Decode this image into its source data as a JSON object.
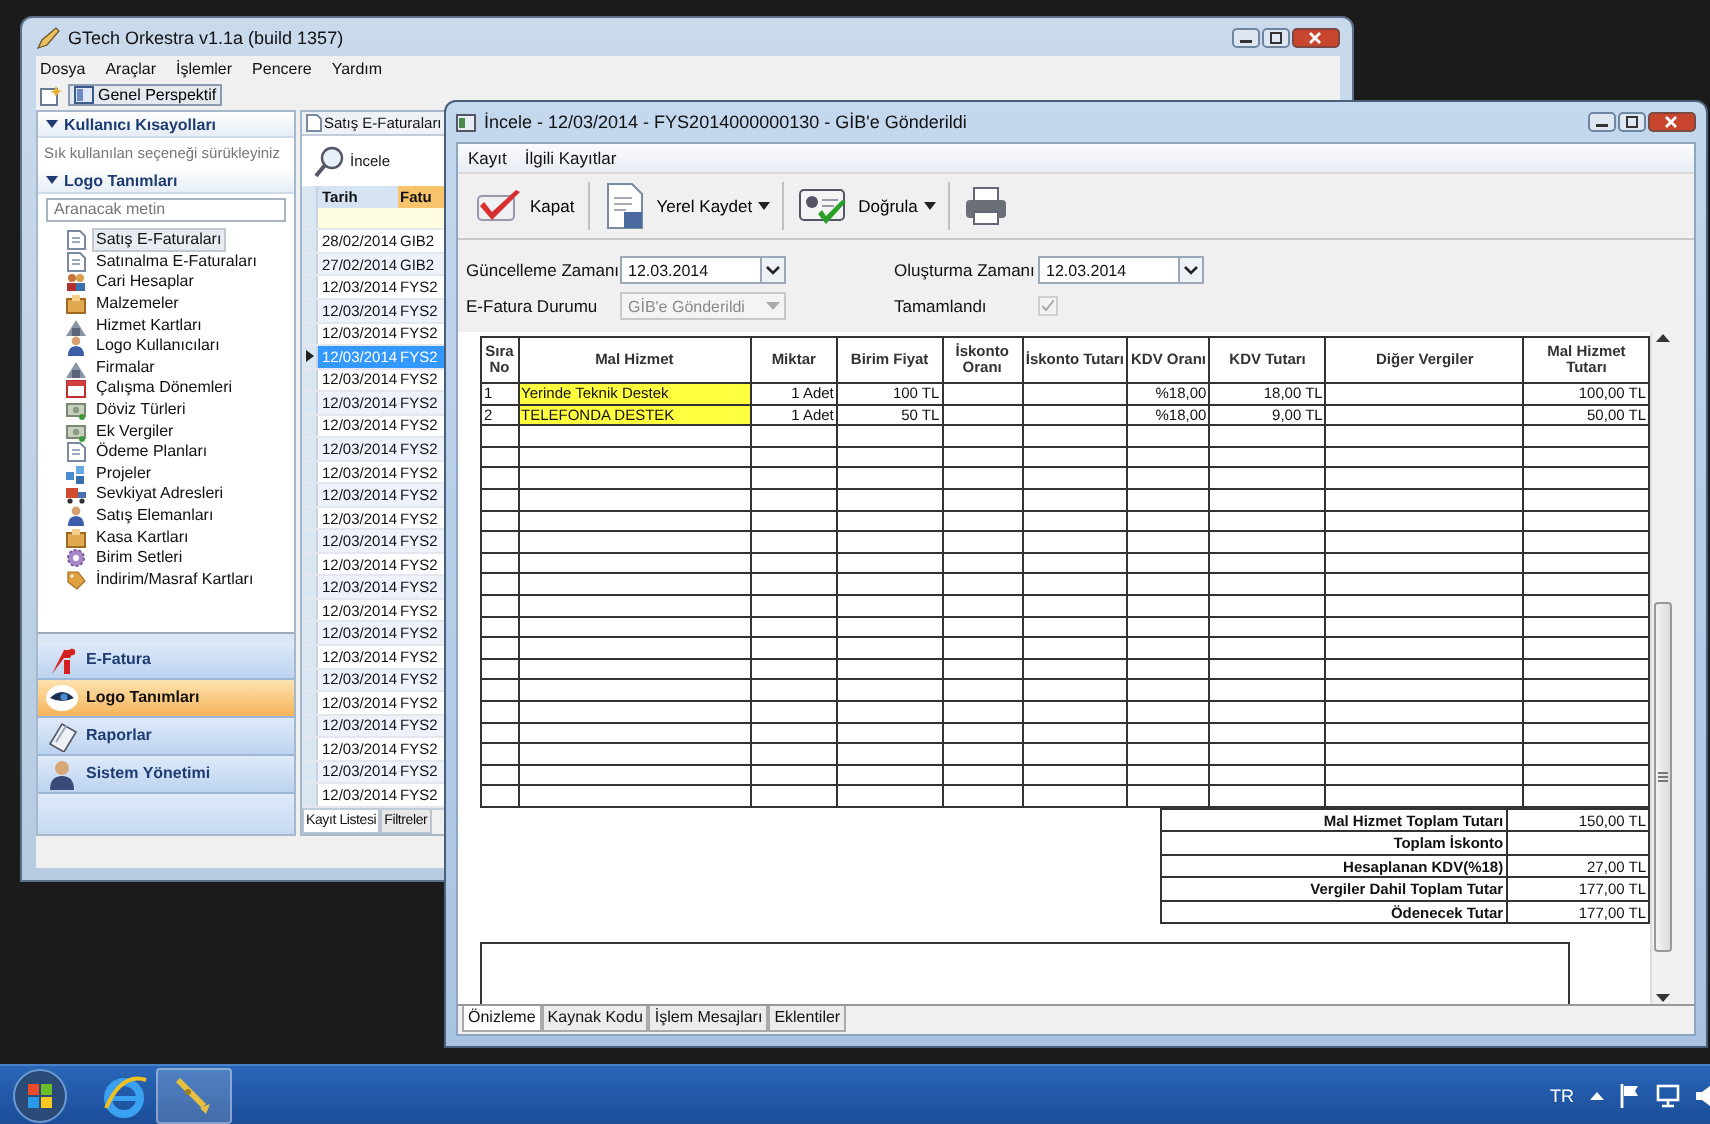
{
  "main_window": {
    "title": "GTech Orkestra v1.1a (build 1357)",
    "menu": [
      "Dosya",
      "Araçlar",
      "İşlemler",
      "Pencere",
      "Yardım"
    ],
    "perspective_button": "Genel Perspektif",
    "shortcuts": {
      "title": "Kullanıcı Kısayolları",
      "expanded": true,
      "hint": "Sık kullanılan seçeneği sürükleyiniz"
    },
    "definitions": {
      "title": "Logo Tanımları",
      "expanded": true,
      "search": {
        "placeholder": "Aranacak metin"
      },
      "items": [
        {
          "label": "Satış E-Faturaları",
          "selected": true
        },
        {
          "label": "Satınalma E-Faturaları",
          "selected": false
        },
        {
          "label": "Cari Hesaplar",
          "selected": false
        },
        {
          "label": "Malzemeler",
          "selected": false
        },
        {
          "label": "Hizmet Kartları",
          "selected": false
        },
        {
          "label": "Logo Kullanıcıları",
          "selected": false
        },
        {
          "label": "Firmalar",
          "selected": false
        },
        {
          "label": "Çalışma Dönemleri",
          "selected": false
        },
        {
          "label": "Döviz Türleri",
          "selected": false
        },
        {
          "label": "Ek Vergiler",
          "selected": false
        },
        {
          "label": "Ödeme Planları",
          "selected": false
        },
        {
          "label": "Projeler",
          "selected": false
        },
        {
          "label": "Sevkiyat Adresleri",
          "selected": false
        },
        {
          "label": "Satış Elemanları",
          "selected": false
        },
        {
          "label": "Kasa Kartları",
          "selected": false
        },
        {
          "label": "Birim Setleri",
          "selected": false
        },
        {
          "label": "İndirim/Masraf Kartları",
          "selected": false
        }
      ]
    },
    "nav": [
      {
        "label": "E-Fatura",
        "selected": false
      },
      {
        "label": "Logo Tanımları",
        "selected": true
      },
      {
        "label": "Raporlar",
        "selected": false
      },
      {
        "label": "Sistem Yönetimi",
        "selected": false
      }
    ],
    "list": {
      "tab": "Satış E-Faturaları",
      "toolbar": [
        "İncele"
      ],
      "columns": [
        {
          "label": "Tarih",
          "sorted": false
        },
        {
          "label": "Fatu",
          "sorted": true
        }
      ],
      "rows": [
        {
          "date": "28/02/2014",
          "number": "GIB2",
          "selected": false
        },
        {
          "date": "27/02/2014",
          "number": "GIB2",
          "selected": false
        },
        {
          "date": "12/03/2014",
          "number": "FYS2",
          "selected": false
        },
        {
          "date": "12/03/2014",
          "number": "FYS2",
          "selected": false
        },
        {
          "date": "12/03/2014",
          "number": "FYS2",
          "selected": false
        },
        {
          "date": "12/03/2014",
          "number": "FYS2",
          "selected": true
        },
        {
          "date": "12/03/2014",
          "number": "FYS2",
          "selected": false
        },
        {
          "date": "12/03/2014",
          "number": "FYS2",
          "selected": false
        },
        {
          "date": "12/03/2014",
          "number": "FYS2",
          "selected": false
        },
        {
          "date": "12/03/2014",
          "number": "FYS2",
          "selected": false
        },
        {
          "date": "12/03/2014",
          "number": "FYS2",
          "selected": false
        },
        {
          "date": "12/03/2014",
          "number": "FYS2",
          "selected": false
        },
        {
          "date": "12/03/2014",
          "number": "FYS2",
          "selected": false
        },
        {
          "date": "12/03/2014",
          "number": "FYS2",
          "selected": false
        },
        {
          "date": "12/03/2014",
          "number": "FYS2",
          "selected": false
        },
        {
          "date": "12/03/2014",
          "number": "FYS2",
          "selected": false
        },
        {
          "date": "12/03/2014",
          "number": "FYS2",
          "selected": false
        },
        {
          "date": "12/03/2014",
          "number": "FYS2",
          "selected": false
        },
        {
          "date": "12/03/2014",
          "number": "FYS2",
          "selected": false
        },
        {
          "date": "12/03/2014",
          "number": "FYS2",
          "selected": false
        },
        {
          "date": "12/03/2014",
          "number": "FYS2",
          "selected": false
        },
        {
          "date": "12/03/2014",
          "number": "FYS2",
          "selected": false
        },
        {
          "date": "12/03/2014",
          "number": "FYS2",
          "selected": false
        },
        {
          "date": "12/03/2014",
          "number": "FYS2",
          "selected": false
        },
        {
          "date": "12/03/2014",
          "number": "FYS2",
          "selected": false
        }
      ],
      "bottom_tabs": [
        {
          "label": "Kayıt Listesi",
          "selected": true
        },
        {
          "label": "Filtreler",
          "selected": false
        }
      ]
    }
  },
  "dialog": {
    "title": "İncele - 12/03/2014 - FYS2014000000130 - GİB'e Gönderildi",
    "menu": [
      "Kayıt",
      "İlgili Kayıtlar"
    ],
    "toolbar": [
      {
        "kind": "close",
        "label": "Kapat",
        "dropdown": false
      },
      {
        "kind": "save",
        "label": "Yerel Kaydet",
        "dropdown": true
      },
      {
        "kind": "verify",
        "label": "Doğrula",
        "dropdown": true
      },
      {
        "kind": "print",
        "dropdown": false
      }
    ],
    "fields": [
      {
        "kind": "date",
        "label": "Güncelleme Zamanı",
        "value": "12.03.2014",
        "disabled": false
      },
      {
        "kind": "date",
        "label": "Oluşturma Zamanı",
        "value": "12.03.2014",
        "disabled": false
      },
      {
        "kind": "combo",
        "label": "E-Fatura Durumu",
        "value": "GİB'e Gönderildi",
        "disabled": true
      },
      {
        "kind": "checkbox",
        "label": "Tamamlandı",
        "checked": true,
        "disabled": true
      }
    ],
    "table": {
      "columns": [
        "Sıra No",
        "Mal Hizmet",
        "Miktar",
        "Birim Fiyat",
        "İskonto Oranı",
        "İskonto Tutarı",
        "KDV Oranı",
        "KDV Tutarı",
        "Diğer Vergiler",
        "Mal Hizmet Tutarı"
      ],
      "rows": [
        {
          "no": "1",
          "item": "Yerinde Teknik Destek",
          "quantity": "1 Adet",
          "unit_price": "100 TL",
          "vat_rate": "%18,00",
          "vat_amount": "18,00 TL",
          "line_total": "100,00 TL",
          "highlighted": true
        },
        {
          "no": "2",
          "item": "TELEFONDA DESTEK",
          "quantity": "1 Adet",
          "unit_price": "50 TL",
          "vat_rate": "%18,00",
          "vat_amount": "9,00 TL",
          "line_total": "50,00 TL",
          "highlighted": true
        }
      ]
    },
    "totals": [
      {
        "label": "Mal Hizmet Toplam Tutarı",
        "value": "150,00 TL"
      },
      {
        "label": "Toplam İskonto"
      },
      {
        "label": "Hesaplanan KDV(%18)",
        "value": "27,00 TL"
      },
      {
        "label": "Vergiler Dahil Toplam Tutar",
        "value": "177,00 TL"
      },
      {
        "label": "Ödenecek Tutar",
        "value": "177,00 TL"
      }
    ],
    "tabs": [
      {
        "label": "Önizleme",
        "selected": true
      },
      {
        "label": "Kaynak Kodu",
        "selected": false
      },
      {
        "label": "İşlem Mesajları",
        "selected": false
      },
      {
        "label": "Eklentiler",
        "selected": false
      }
    ]
  },
  "taskbar": {
    "language": "TR"
  }
}
